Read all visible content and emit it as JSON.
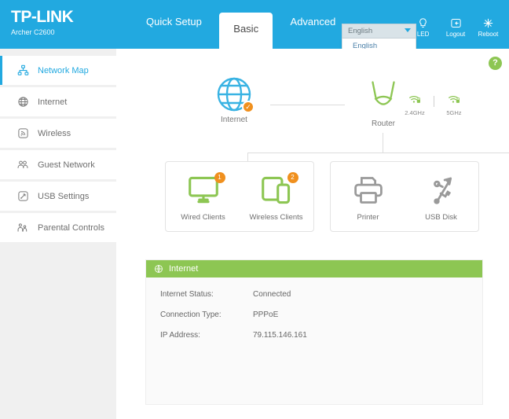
{
  "header": {
    "brand": "TP-LINK",
    "model": "Archer C2600",
    "tabs": [
      {
        "label": "Quick Setup",
        "active": false
      },
      {
        "label": "Basic",
        "active": true
      },
      {
        "label": "Advanced",
        "active": false
      }
    ],
    "language": {
      "selected": "English",
      "options": [
        "English"
      ],
      "expanded": true
    },
    "icons": [
      {
        "name": "led-icon",
        "label": "LED"
      },
      {
        "name": "logout-icon",
        "label": "Logout"
      },
      {
        "name": "reboot-icon",
        "label": "Reboot"
      }
    ]
  },
  "sidebar": {
    "items": [
      {
        "label": "Network Map",
        "icon": "network-map-icon",
        "active": true
      },
      {
        "label": "Internet",
        "icon": "globe-icon",
        "active": false
      },
      {
        "label": "Wireless",
        "icon": "wireless-signal-icon",
        "active": false
      },
      {
        "label": "Guest Network",
        "icon": "guest-network-icon",
        "active": false
      },
      {
        "label": "USB Settings",
        "icon": "usb-settings-icon",
        "active": false
      },
      {
        "label": "Parental Controls",
        "icon": "parental-controls-icon",
        "active": false
      }
    ]
  },
  "help": {
    "label": "?"
  },
  "topology": {
    "internet": {
      "label": "Internet",
      "status_badge": "✓"
    },
    "router": {
      "label": "Router"
    },
    "wifi": [
      {
        "label": "2.4GHz",
        "secured": true
      },
      {
        "label": "5GHz",
        "secured": true
      }
    ],
    "devices": [
      {
        "label": "Wired Clients",
        "count": "1",
        "active": true
      },
      {
        "label": "Wireless Clients",
        "count": "2",
        "active": true
      },
      {
        "label": "Printer",
        "count": "",
        "active": false
      },
      {
        "label": "USB Disk",
        "count": "",
        "active": false
      }
    ]
  },
  "internet_panel": {
    "title": "Internet",
    "rows": [
      {
        "key": "Internet Status:",
        "value": "Connected"
      },
      {
        "key": "Connection Type:",
        "value": "PPPoE"
      },
      {
        "key": "IP Address:",
        "value": "79.115.146.161"
      }
    ]
  },
  "colors": {
    "header_blue": "#22a9e0",
    "accent_green": "#8dc653",
    "badge_orange": "#f0901e",
    "sidebar_bg": "#f0f0f0"
  }
}
